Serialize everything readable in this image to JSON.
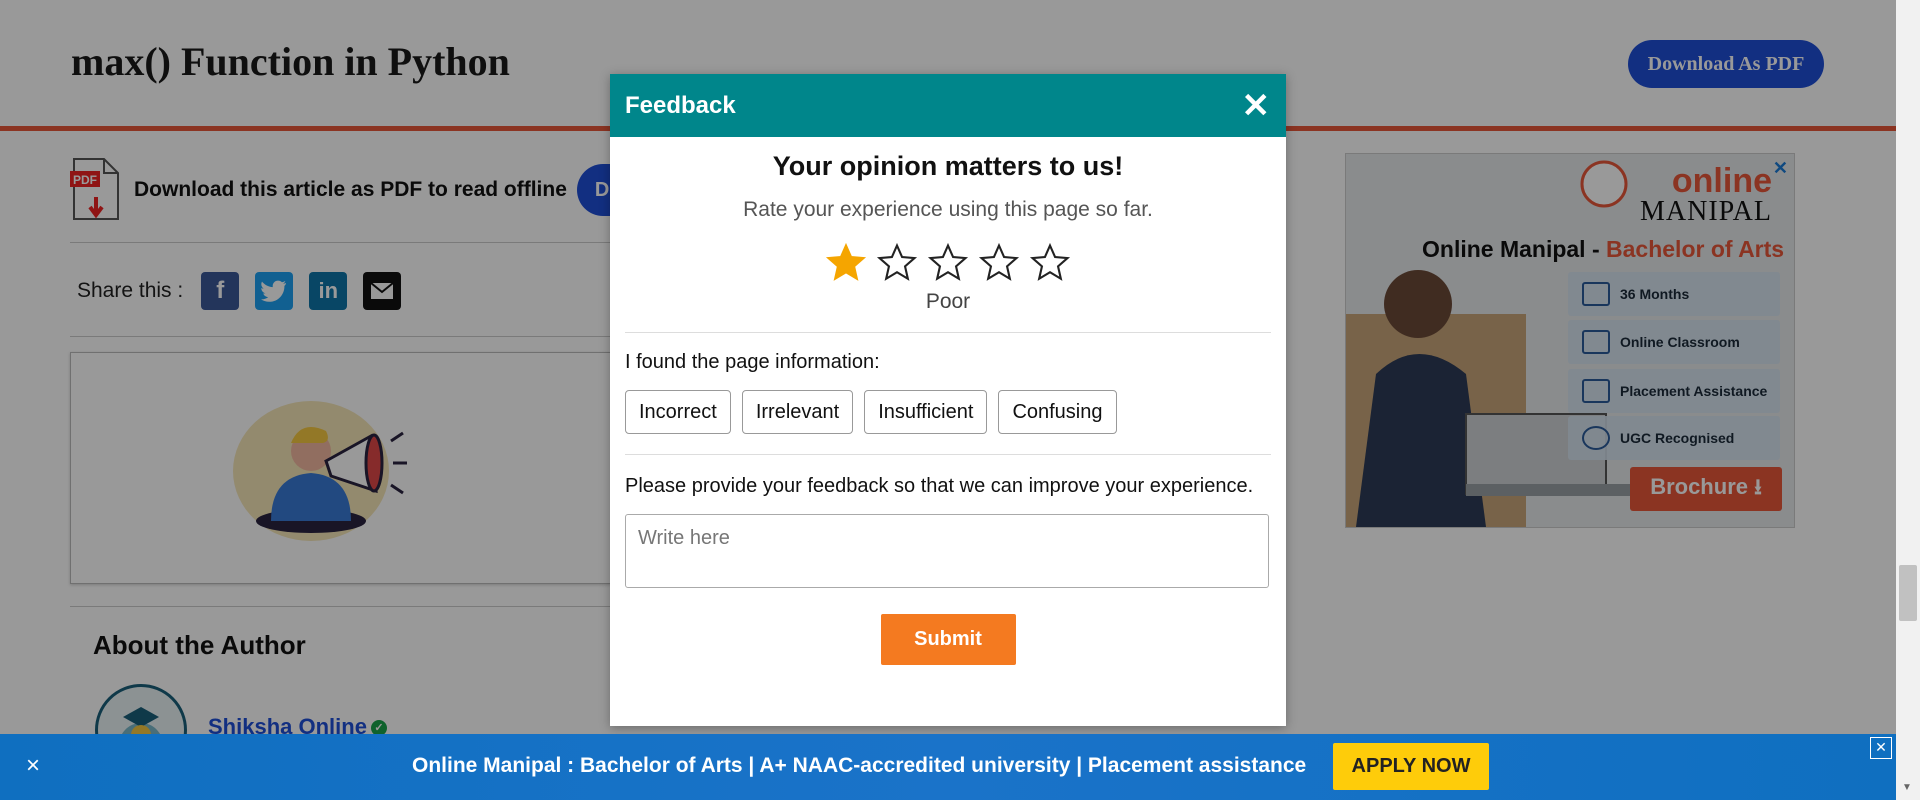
{
  "header": {
    "title": "max() Function in Python",
    "download_pdf_button": "Download As PDF"
  },
  "pdf_row": {
    "icon_text": "PDF",
    "text": "Download this article as PDF to read offline",
    "button_partial": "D"
  },
  "share": {
    "label": "Share this :",
    "icons": [
      "facebook-icon",
      "twitter-icon",
      "linkedin-icon",
      "email-icon"
    ]
  },
  "author": {
    "heading": "About the Author",
    "name": "Shiksha Online"
  },
  "ad": {
    "logo_line1": "online",
    "logo_line2": "MANIPAL",
    "headline": "Online Manipal - ",
    "headline_accent": "Bachelor of Arts",
    "features": [
      "36 Months",
      "Online Classroom",
      "Placement Assistance",
      "UGC Recognised"
    ],
    "cta": "Brochure"
  },
  "modal": {
    "title": "Feedback",
    "heading": "Your opinion matters to us!",
    "subheading": "Rate your experience using this page so far.",
    "rating": 1,
    "max_rating": 5,
    "rating_label": "Poor",
    "question": "I found the page information:",
    "options": [
      "Incorrect",
      "Irrelevant",
      "Insufficient",
      "Confusing"
    ],
    "feedback_prompt": "Please provide your feedback so that we can improve your experience.",
    "input_placeholder": "Write here",
    "submit_label": "Submit"
  },
  "banner": {
    "close": "×",
    "text": "Online Manipal : Bachelor of Arts | A+ NAAC-accredited university | Placement assistance",
    "cta": "APPLY NOW",
    "ad_close": "✕"
  },
  "colors": {
    "header_rule": "#e8573a",
    "primary_blue": "#1f4fd8",
    "modal_header": "#00868b",
    "star_filled": "#f5a500",
    "submit": "#f47a20",
    "apply": "#fecc0a"
  }
}
